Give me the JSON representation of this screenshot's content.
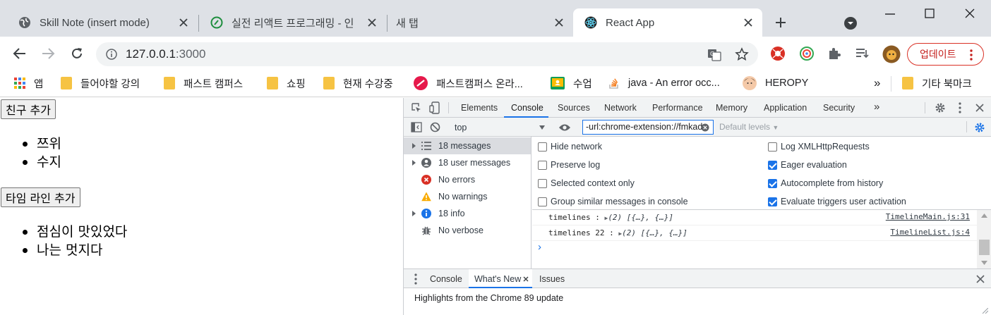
{
  "browser": {
    "tabs": [
      {
        "title": "Skill Note (insert mode)",
        "icon": "globe-icon",
        "active": false
      },
      {
        "title": "실전 리액트 프로그래밍 - 인",
        "icon": "leaf-icon",
        "active": false
      },
      {
        "title": "새 탭",
        "icon": "",
        "active": false
      },
      {
        "title": "React App",
        "icon": "react-icon",
        "active": true
      }
    ],
    "url_host": "127.0.0.1",
    "url_port": ":3000",
    "update_label": "업데이트",
    "bookmarks": [
      {
        "label": "앱",
        "icon": "apps-grid-icon"
      },
      {
        "label": "들어야할 강의",
        "icon": "folder-icon"
      },
      {
        "label": "패스트 캠퍼스",
        "icon": "folder-icon"
      },
      {
        "label": "쇼핑",
        "icon": "folder-icon"
      },
      {
        "label": "현재 수강중",
        "icon": "folder-icon"
      },
      {
        "label": "패스트캠퍼스 온라...",
        "icon": "fastcampus-icon"
      },
      {
        "label": "수업",
        "icon": "classroom-icon"
      },
      {
        "label": "java - An error occ...",
        "icon": "stackoverflow-icon"
      },
      {
        "label": "HEROPY",
        "icon": "avatar-icon"
      }
    ],
    "bookmarks_overflow": "»",
    "other_bookmarks": "기타 북마크"
  },
  "page": {
    "add_friend_label": "친구 추가",
    "friends": [
      "쯔위",
      "수지"
    ],
    "add_timeline_label": "타임 라인 추가",
    "timelines": [
      "점심이 맛있었다",
      "나는 멋지다"
    ]
  },
  "devtools": {
    "tabs": [
      "Elements",
      "Console",
      "Sources",
      "Network",
      "Performance",
      "Memory",
      "Application",
      "Security"
    ],
    "active_tab": "Console",
    "more_tabs": "»",
    "context": "top",
    "filter_value": "-url:chrome-extension://fmkad",
    "levels": "Default levels",
    "sidebar": [
      {
        "label": "18 messages",
        "icon": "list-icon",
        "expandable": true
      },
      {
        "label": "18 user messages",
        "icon": "user-icon",
        "expandable": true
      },
      {
        "label": "No errors",
        "icon": "error-icon",
        "expandable": false
      },
      {
        "label": "No warnings",
        "icon": "warning-icon",
        "expandable": false
      },
      {
        "label": "18 info",
        "icon": "info-icon",
        "expandable": true
      },
      {
        "label": "No verbose",
        "icon": "bug-icon",
        "expandable": false
      }
    ],
    "settings_left": [
      {
        "label": "Hide network",
        "checked": false
      },
      {
        "label": "Preserve log",
        "checked": false
      },
      {
        "label": "Selected context only",
        "checked": false
      },
      {
        "label": "Group similar messages in console",
        "checked": false
      }
    ],
    "settings_right": [
      {
        "label": "Log XMLHttpRequests",
        "checked": false
      },
      {
        "label": "Eager evaluation",
        "checked": true
      },
      {
        "label": "Autocomplete from history",
        "checked": true
      },
      {
        "label": "Evaluate triggers user activation",
        "checked": true
      }
    ],
    "logs": [
      {
        "prefix": "timelines : ",
        "object": "(2) [{…}, {…}]",
        "source": "TimelineMain.js:31"
      },
      {
        "prefix": "timelines 22 : ",
        "object": "(2) [{…}, {…}]",
        "source": "TimelineList.js:4"
      }
    ],
    "prompt": "›",
    "drawer_tabs": [
      "Console",
      "What's New",
      "Issues"
    ],
    "drawer_active": "What's New",
    "highlights": "Highlights from the Chrome 89 update"
  },
  "colors": {
    "accent": "#1a73e8",
    "tabstrip": "#dee1e6",
    "update_red": "#d93025"
  }
}
